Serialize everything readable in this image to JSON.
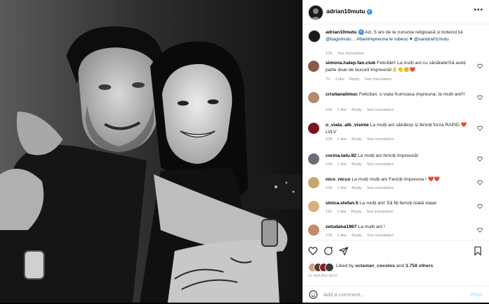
{
  "post": {
    "username": "adrian10mutu",
    "caption_user": "adrian10mutu",
    "caption_text": "Azi, 5 ani de la cununia religioasă și botezul lui",
    "caption_mention": "@tiagomutu",
    "caption_hashtag": ".. #8aniimpreuna te iubesc ♥",
    "caption_mention2": "@sandra01mutu",
    "caption_time": "10h",
    "caption_translate": "See translation"
  },
  "comments": [
    {
      "user": "simona.halep.fan.club",
      "text": "Felicitări! La mulți ani cu sănătate!Să aveți parte doar de bucurii împreună!👌👏😊❤️",
      "time": "7h",
      "likes": "1 like",
      "reply": "Reply",
      "translate": "See translation",
      "avatar_color": "#8a5a4a"
    },
    {
      "user": "cristianatimuc",
      "text": "Felicitari, o viata frumoasa impreuna, la multi ani!!!",
      "time": "10h",
      "likes": "1 like",
      "reply": "Reply",
      "translate": "See translation",
      "avatar_color": "#b48a6a"
    },
    {
      "user": "o_viata_alb_visinie",
      "text": "La mulți ani sănătoși și fericiți forza RAPID ❤️LVLV",
      "time": "10h",
      "likes": "1 like",
      "reply": "Reply",
      "translate": "See translation",
      "avatar_color": "#7a1620"
    },
    {
      "user": "corina.tatu.92",
      "text": "La mulți ani fericiți împreună!",
      "time": "10h",
      "likes": "1 like",
      "reply": "Reply",
      "translate": "See translation",
      "avatar_color": "#6b6f78"
    },
    {
      "user": "nico_nicco",
      "text": "La mulți mulți ani Fericiți împreuna ! ❤️❤️",
      "time": "10h",
      "likes": "1 like",
      "reply": "Reply",
      "translate": "See translation",
      "avatar_color": "#c9a46a"
    },
    {
      "user": "sinica.stefan.5",
      "text": "La mulți ani! Să fiți fericiți toată viața!",
      "time": "11h",
      "likes": "1 like",
      "reply": "Reply",
      "translate": "See translation",
      "avatar_color": "#d8b080"
    },
    {
      "user": "zetudana1967",
      "text": "La multi ani !",
      "time": "10h",
      "likes": "1 like",
      "reply": "Reply",
      "translate": "See translation",
      "avatar_color": "#c78a6a"
    }
  ],
  "likes": {
    "prefix": "Liked by",
    "user": "octavian_cocolos",
    "middle": "and",
    "count": "3.759 others"
  },
  "timestamp": "11 HOURS AGO",
  "add_comment": {
    "placeholder": "Add a comment...",
    "post_label": "Post"
  },
  "colors": {
    "verified": "#3897f0",
    "link": "#00376b",
    "post_disabled": "#b2dffc",
    "muted": "#8e8e8e"
  }
}
